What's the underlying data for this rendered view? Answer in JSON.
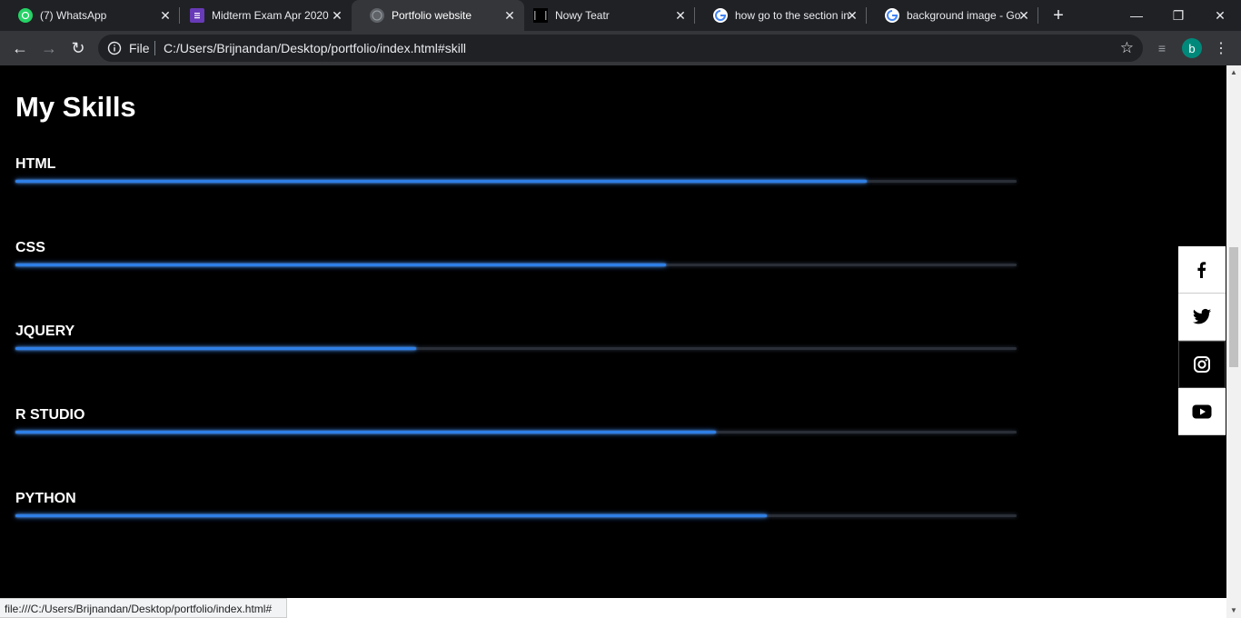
{
  "browser": {
    "tabs": [
      {
        "title": "(7) WhatsApp",
        "icon": "whatsapp-icon"
      },
      {
        "title": "Midterm Exam Apr 2020",
        "icon": "forms-icon"
      },
      {
        "title": "Portfolio website",
        "icon": "globe-icon",
        "active": true
      },
      {
        "title": "Nowy Teatr",
        "icon": "nowy-teatr-icon"
      },
      {
        "title": "how go to the section in",
        "icon": "google-icon"
      },
      {
        "title": "background image - Go",
        "icon": "google-icon"
      }
    ],
    "omnibox": {
      "scheme_label": "File",
      "url": "C:/Users/Brijnandan/Desktop/portfolio/index.html#skill"
    },
    "profile_initial": "b",
    "status_url": "file:///C:/Users/Brijnandan/Desktop/portfolio/index.html#"
  },
  "page": {
    "heading": "My Skills",
    "skills": [
      {
        "name": "HTML",
        "level": 0.85
      },
      {
        "name": "CSS",
        "level": 0.65
      },
      {
        "name": "JQUERY",
        "level": 0.4
      },
      {
        "name": "R STUDIO",
        "level": 0.7
      },
      {
        "name": "PYTHON",
        "level": 0.75
      }
    ],
    "social": [
      "facebook-icon",
      "twitter-icon",
      "instagram-icon",
      "youtube-icon"
    ]
  },
  "colors": {
    "accent": "#2f7fe6",
    "track": "#2a2e36",
    "chrome_dark": "#202124",
    "chrome_toolbar": "#35363a"
  }
}
